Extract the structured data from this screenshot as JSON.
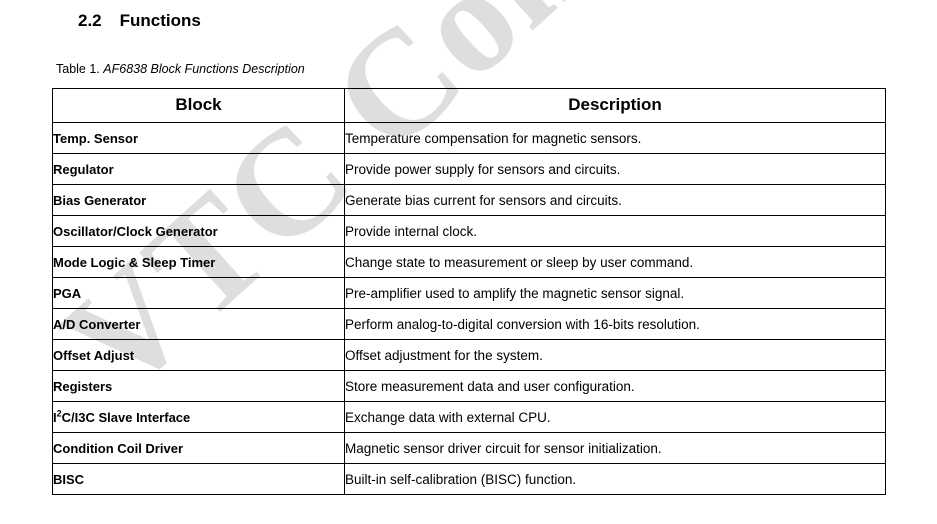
{
  "watermark": {
    "text": "VTC Confidential",
    "color": "#dedede"
  },
  "section": {
    "number": "2.2",
    "title": "Functions"
  },
  "caption": {
    "label": "Table 1.",
    "title": "AF6838 Block Functions Description"
  },
  "table": {
    "columns": [
      "Block",
      "Description"
    ],
    "rows": [
      {
        "block": "Temp. Sensor",
        "block_sup": "",
        "block_tail": "",
        "description": "Temperature compensation for magnetic sensors."
      },
      {
        "block": "Regulator",
        "block_sup": "",
        "block_tail": "",
        "description": "Provide power supply for sensors and circuits."
      },
      {
        "block": "Bias Generator",
        "block_sup": "",
        "block_tail": "",
        "description": "Generate bias current for sensors and circuits."
      },
      {
        "block": "Oscillator/Clock Generator",
        "block_sup": "",
        "block_tail": "",
        "description": "Provide internal clock."
      },
      {
        "block": "Mode Logic & Sleep Timer",
        "block_sup": "",
        "block_tail": "",
        "description": "Change state to measurement or sleep by user command."
      },
      {
        "block": "PGA",
        "block_sup": "",
        "block_tail": "",
        "description": "Pre-amplifier used to amplify the magnetic sensor signal."
      },
      {
        "block": "A/D Converter",
        "block_sup": "",
        "block_tail": "",
        "description": "Perform analog-to-digital conversion with 16-bits resolution."
      },
      {
        "block": "Offset Adjust",
        "block_sup": "",
        "block_tail": "",
        "description": "Offset adjustment for the system."
      },
      {
        "block": "Registers",
        "block_sup": "",
        "block_tail": "",
        "description": "Store measurement data and user configuration."
      },
      {
        "block": "I",
        "block_sup": "2",
        "block_tail": "C/I3C Slave Interface",
        "description": "Exchange data with external CPU."
      },
      {
        "block": "Condition Coil Driver",
        "block_sup": "",
        "block_tail": "",
        "description": "Magnetic sensor driver circuit for sensor initialization."
      },
      {
        "block": "BISC",
        "block_sup": "",
        "block_tail": "",
        "description": "Built-in self-calibration (BISC) function."
      }
    ]
  }
}
